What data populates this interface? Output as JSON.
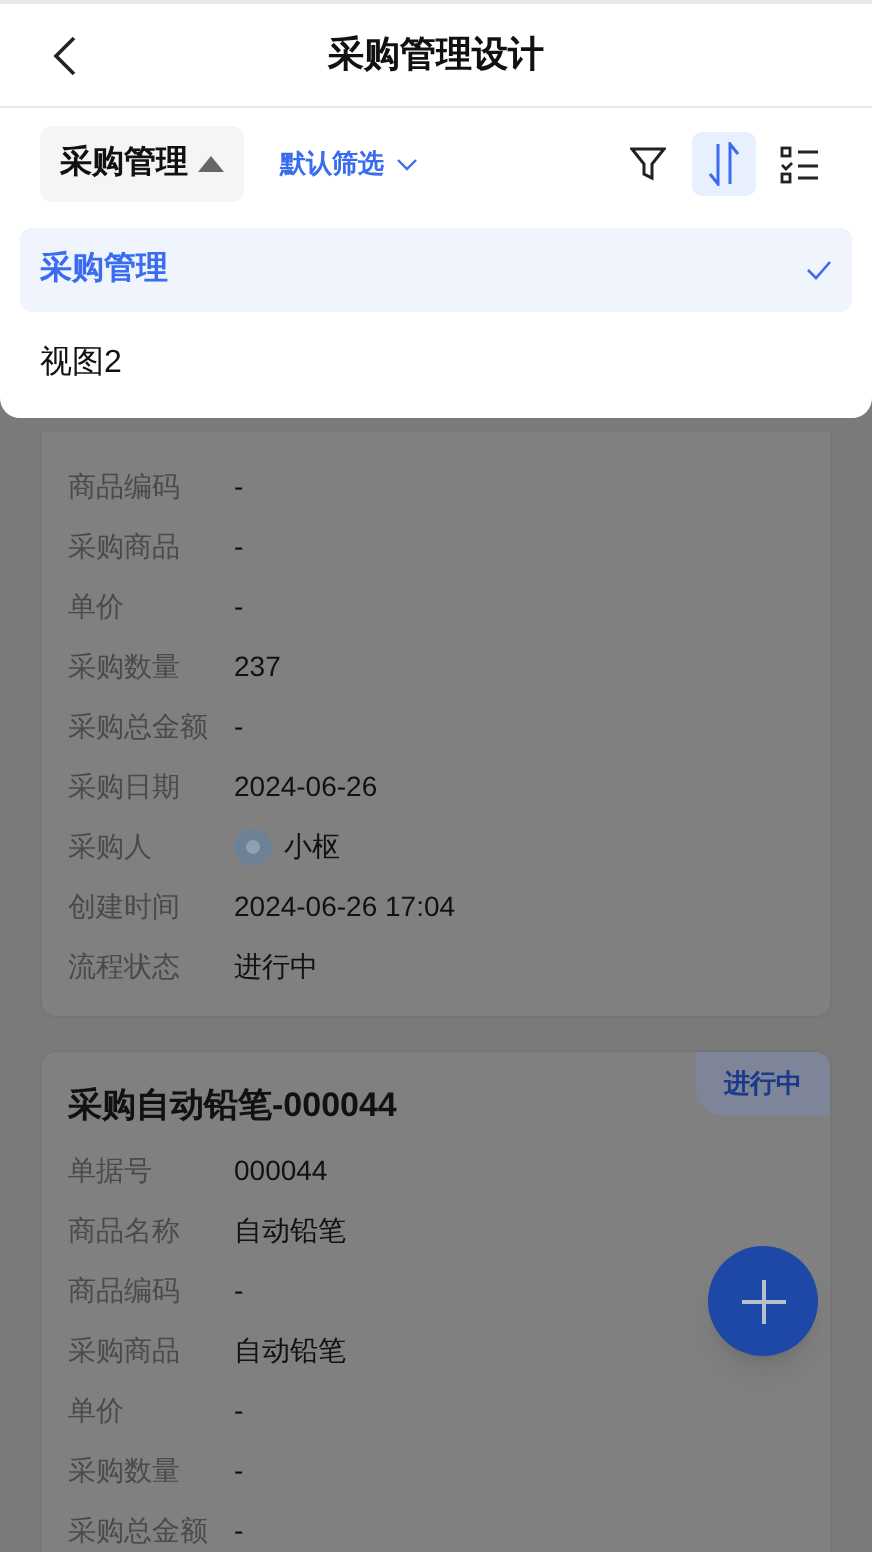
{
  "header": {
    "title": "采购管理设计"
  },
  "toolbar": {
    "view_button": "采购管理",
    "filter_button": "默认筛选",
    "sort_active": true
  },
  "view_menu": [
    {
      "label": "采购管理",
      "selected": true
    },
    {
      "label": "视图2",
      "selected": false
    }
  ],
  "cards": [
    {
      "rows": [
        {
          "label": "商品编码",
          "value": "-"
        },
        {
          "label": "采购商品",
          "value": "-"
        },
        {
          "label": "单价",
          "value": "-"
        },
        {
          "label": "采购数量",
          "value": "237"
        },
        {
          "label": "采购总金额",
          "value": "-"
        },
        {
          "label": "采购日期",
          "value": "2024-06-26"
        },
        {
          "label": "采购人",
          "value": "小枢",
          "kind": "person"
        },
        {
          "label": "创建时间",
          "value": "2024-06-26 17:04"
        },
        {
          "label": "流程状态",
          "value": "进行中"
        }
      ]
    },
    {
      "title": "采购自动铅笔-000044",
      "status": "进行中",
      "rows": [
        {
          "label": "单据号",
          "value": "000044"
        },
        {
          "label": "商品名称",
          "value": "自动铅笔"
        },
        {
          "label": "商品编码",
          "value": "-"
        },
        {
          "label": "采购商品",
          "value": "自动铅笔"
        },
        {
          "label": "单价",
          "value": "-"
        },
        {
          "label": "采购数量",
          "value": "-"
        },
        {
          "label": "采购总金额",
          "value": "-"
        }
      ]
    }
  ]
}
